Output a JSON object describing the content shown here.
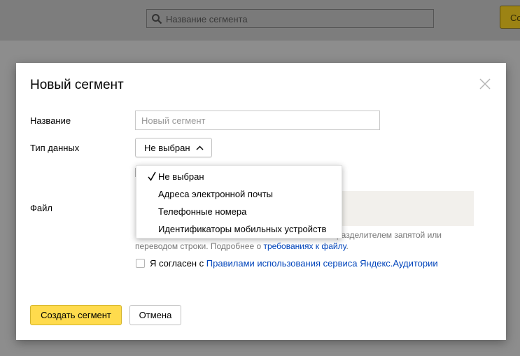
{
  "background": {
    "search_placeholder": "Название сегмента",
    "button_label": "Со"
  },
  "modal": {
    "title": "Новый сегмент",
    "name_label": "Название",
    "name_placeholder": "Новый сегмент",
    "type_label": "Тип данных",
    "type_selected": "Не выбран",
    "file_label": "Файл",
    "hint_text_tail": "разделителем запятой или",
    "hint_text_line2_prefix": "переводом строки. Подробнее о ",
    "hint_link": "требованиях к файлу",
    "hint_text_end": ".",
    "agree_prefix": "Я согласен с ",
    "agree_link": "Правилами использования сервиса Яндекс.Аудитории",
    "create_button": "Создать сегмент",
    "cancel_button": "Отмена"
  },
  "dropdown": {
    "items": [
      {
        "label": "Не выбран",
        "checked": true
      },
      {
        "label": "Адреса электронной почты",
        "checked": false
      },
      {
        "label": "Телефонные номера",
        "checked": false
      },
      {
        "label": "Идентификаторы мобильных устройств",
        "checked": false
      }
    ]
  },
  "colors": {
    "accent_yellow": "#ffdb4d",
    "link_blue": "#0044bb"
  }
}
